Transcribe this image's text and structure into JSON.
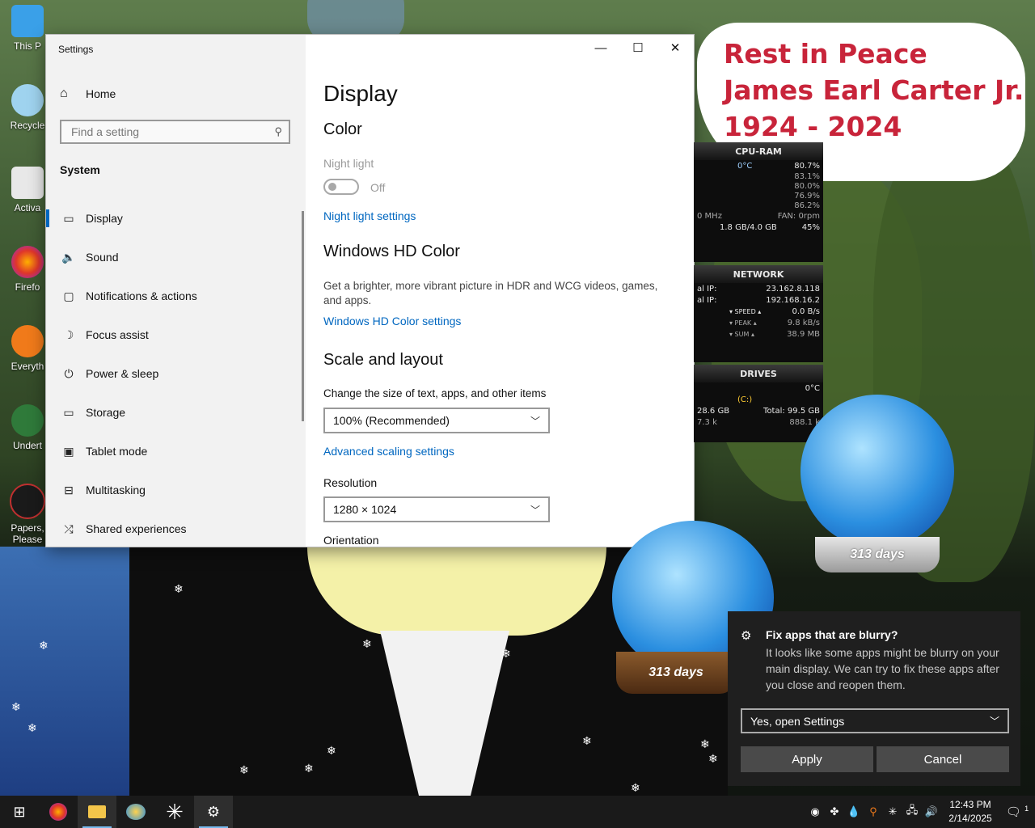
{
  "desktop": {
    "icons": [
      {
        "label": "This P"
      },
      {
        "label": "Recycle"
      },
      {
        "label": "Activa"
      },
      {
        "label": "Firefo"
      },
      {
        "label": "Everyth"
      },
      {
        "label": "Undert"
      },
      {
        "label": "Papers, Please"
      }
    ]
  },
  "window": {
    "title": "Settings",
    "controls": {
      "minimize": "—",
      "maximize": "☐",
      "close": "✕"
    }
  },
  "sidebar": {
    "home_label": "Home",
    "search_placeholder": "Find a setting",
    "section_title": "System",
    "items": [
      {
        "label": "Display",
        "icon": "monitor-icon",
        "glyph": "▭"
      },
      {
        "label": "Sound",
        "icon": "speaker-icon",
        "glyph": "🔈"
      },
      {
        "label": "Notifications & actions",
        "icon": "message-icon",
        "glyph": "▢"
      },
      {
        "label": "Focus assist",
        "icon": "moon-icon",
        "glyph": "☽"
      },
      {
        "label": "Power & sleep",
        "icon": "power-icon",
        "glyph": "⏻"
      },
      {
        "label": "Storage",
        "icon": "storage-icon",
        "glyph": "▭"
      },
      {
        "label": "Tablet mode",
        "icon": "tablet-icon",
        "glyph": "▣"
      },
      {
        "label": "Multitasking",
        "icon": "multitasking-icon",
        "glyph": "⊟"
      },
      {
        "label": "Shared experiences",
        "icon": "share-icon",
        "glyph": "⤮"
      }
    ]
  },
  "main": {
    "page_title": "Display",
    "color_header": "Color",
    "night_light_label": "Night light",
    "night_light_state": "Off",
    "night_light_link": "Night light settings",
    "hd_header": "Windows HD Color",
    "hd_desc": "Get a brighter, more vibrant picture in HDR and WCG videos, games, and apps.",
    "hd_link": "Windows HD Color settings",
    "scale_header": "Scale and layout",
    "scale_label": "Change the size of text, apps, and other items",
    "scale_value": "100% (Recommended)",
    "scaling_link": "Advanced scaling settings",
    "resolution_label": "Resolution",
    "resolution_value": "1280 × 1024",
    "orientation_label": "Orientation"
  },
  "sign": {
    "line1": "Rest in Peace",
    "line2": "James Earl Carter Jr.",
    "line3": "1924 - 2024"
  },
  "gadgets": {
    "cpu": {
      "title": "CPU-RAM",
      "temp": "0°C",
      "cores": [
        "80.7%",
        "83.1%",
        "80.0%",
        "76.9%",
        "86.2%"
      ],
      "mhz": "0 MHz",
      "fan": "FAN: 0rpm",
      "ram": "1.8 GB/4.0 GB",
      "ram_pct": "45%"
    },
    "network": {
      "title": "NETWORK",
      "ext_label": "al IP:",
      "ext_ip": "23.162.8.118",
      "int_label": "al IP:",
      "int_ip": "192.168.16.2",
      "speed_label": "▾ SPEED ▴",
      "speed": "0.0 B/s",
      "peak_label": "▾ PEAK ▴",
      "peak": "9.8 kB/s",
      "sum_label": "▾ SUM ▴",
      "sum": "38.9 MB"
    },
    "drives": {
      "title": "DRIVES",
      "temp": "0°C",
      "drive": "(C:)",
      "free": "28.6 GB",
      "total": "Total: 99.5 GB",
      "read": "7.3 k",
      "write": "888.1 k"
    }
  },
  "globes": {
    "right_days": "313 days",
    "left_days": "313 days"
  },
  "toast": {
    "title": "Fix apps that are blurry?",
    "body": "It looks like some apps might be blurry on your main display. We can try to fix these apps after you close and reopen them.",
    "select_value": "Yes, open Settings",
    "apply_label": "Apply",
    "cancel_label": "Cancel"
  },
  "taskbar": {
    "time": "12:43 PM",
    "date": "2/14/2025",
    "notification_count": "1"
  }
}
